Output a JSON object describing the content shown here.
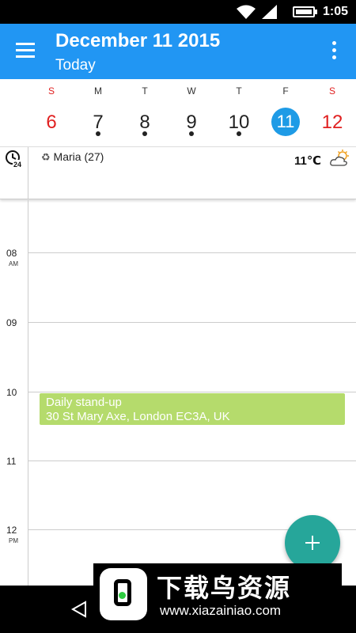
{
  "status_bar": {
    "time": "1:05"
  },
  "app_bar": {
    "title": "December 11 2015",
    "subtitle": "Today"
  },
  "week": {
    "days": [
      {
        "letter": "S",
        "num": "6",
        "color": "#e02020",
        "dot": false
      },
      {
        "letter": "M",
        "num": "7",
        "color": "#222222",
        "dot": true
      },
      {
        "letter": "T",
        "num": "8",
        "color": "#222222",
        "dot": true
      },
      {
        "letter": "W",
        "num": "9",
        "color": "#222222",
        "dot": true
      },
      {
        "letter": "T",
        "num": "10",
        "color": "#222222",
        "dot": true
      },
      {
        "letter": "F",
        "num": "11",
        "color": "#ffffff",
        "dot": false,
        "selected": true
      },
      {
        "letter": "S",
        "num": "12",
        "color": "#e02020",
        "dot": false
      }
    ],
    "weekend_header_color": "#e02020",
    "selected_color": "#1e9be6"
  },
  "all_day": {
    "birthday": "Maria (27)",
    "temperature": "11℃",
    "clock_badge": "24"
  },
  "hours": [
    {
      "label": "08",
      "ampm": "AM"
    },
    {
      "label": "09",
      "ampm": ""
    },
    {
      "label": "10",
      "ampm": ""
    },
    {
      "label": "11",
      "ampm": ""
    },
    {
      "label": "12",
      "ampm": "PM"
    }
  ],
  "event": {
    "title": "Daily stand-up",
    "location": "30 St Mary Axe, London EC3A, UK",
    "color": "#b5db6c"
  },
  "colors": {
    "primary": "#2196f3",
    "fab": "#26a69a"
  },
  "watermark": {
    "title": "下载鸟资源",
    "url": "www.xiazainiao.com"
  }
}
